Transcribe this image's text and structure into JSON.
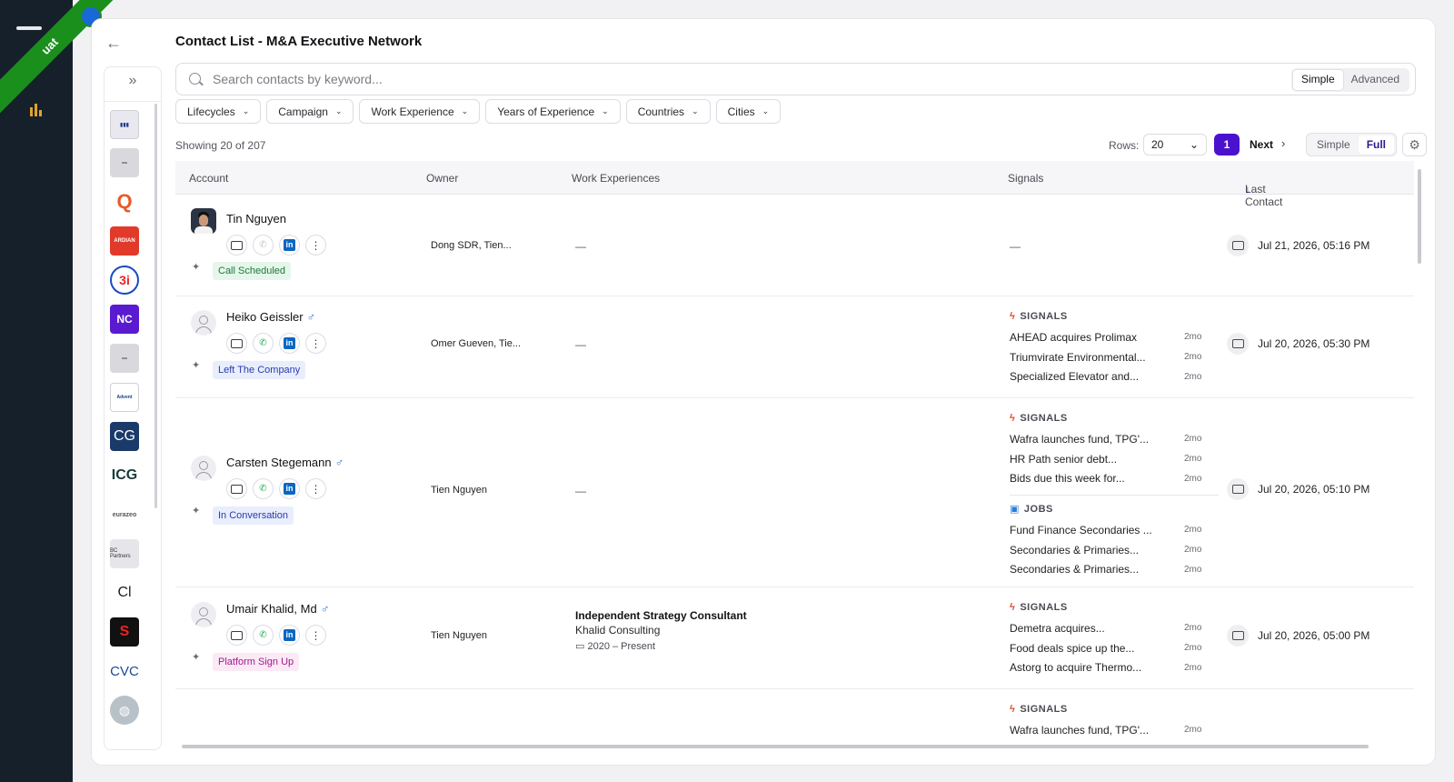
{
  "app": {
    "env_badge": "uat",
    "title": "Contact List - M&A Executive Network"
  },
  "search": {
    "placeholder": "Search contacts by keyword...",
    "modes": [
      "Simple",
      "Advanced"
    ],
    "active_mode": "Simple"
  },
  "filters": [
    "Lifecycles",
    "Campaign",
    "Work Experience",
    "Years of Experience",
    "Countries",
    "Cities"
  ],
  "toolbar": {
    "showing": "Showing 20 of 207",
    "rows_label": "Rows:",
    "rows_value": "20",
    "page": "1",
    "next": "Next",
    "views": [
      "Simple",
      "Full"
    ],
    "active_view": "Full"
  },
  "columns": [
    "Account",
    "Owner",
    "Work Experiences",
    "Signals",
    "Last Contact"
  ],
  "accounts": [
    "Bitcoin",
    "grey-logo",
    "Q-logo",
    "ARDIAN",
    "3i",
    "NC",
    "grey-logo-2",
    "Advent International",
    "CG",
    "ICG",
    "eurazeo",
    "BC Partners",
    "Cl",
    "red-swirl",
    "CVC",
    "globe"
  ],
  "rows": [
    {
      "name": "Tin Nguyen",
      "gender": "",
      "stage": "Call Scheduled",
      "owner": "Dong SDR, Tien...",
      "work": "—",
      "signals_text": "—",
      "last_contact": "Jul 21, 2026, 05:16 PM"
    },
    {
      "name": "Heiko Geissler",
      "gender": "♂",
      "stage": "Left The Company",
      "owner": "Omer Gueven, Tie...",
      "work": "—",
      "signals_label": "SIGNALS",
      "signals": [
        {
          "text": "AHEAD acquires Prolimax",
          "ago": "2mo"
        },
        {
          "text": "Triumvirate Environmental...",
          "ago": "2mo"
        },
        {
          "text": "Specialized Elevator and...",
          "ago": "2mo"
        }
      ],
      "last_contact": "Jul 20, 2026, 05:30 PM"
    },
    {
      "name": "Carsten Stegemann",
      "gender": "♂",
      "stage": "In Conversation",
      "owner": "Tien Nguyen",
      "work": "—",
      "signals_label": "SIGNALS",
      "signals": [
        {
          "text": "Wafra launches fund, TPG'...",
          "ago": "2mo"
        },
        {
          "text": "HR Path senior debt...",
          "ago": "2mo"
        },
        {
          "text": "Bids due this week for...",
          "ago": "2mo"
        }
      ],
      "jobs_label": "JOBS",
      "jobs": [
        {
          "text": "Fund Finance Secondaries ...",
          "ago": "2mo"
        },
        {
          "text": "Secondaries & Primaries...",
          "ago": "2mo"
        },
        {
          "text": "Secondaries & Primaries...",
          "ago": "2mo"
        }
      ],
      "last_contact": "Jul 20, 2026, 05:10 PM"
    },
    {
      "name": "Umair Khalid, Md",
      "gender": "♂",
      "stage": "Platform Sign Up",
      "owner": "Tien Nguyen",
      "work_title": "Independent Strategy Consultant",
      "work_company": "Khalid Consulting",
      "work_dates": "2020 – Present",
      "signals_label": "SIGNALS",
      "signals": [
        {
          "text": "Demetra acquires...",
          "ago": "2mo"
        },
        {
          "text": "Food deals spice up the...",
          "ago": "2mo"
        },
        {
          "text": "Astorg to acquire Thermo...",
          "ago": "2mo"
        }
      ],
      "last_contact": "Jul 20, 2026, 05:00 PM"
    },
    {
      "signals_label": "SIGNALS",
      "signals": [
        {
          "text": "Wafra launches fund, TPG'...",
          "ago": "2mo"
        }
      ]
    }
  ],
  "colors": {
    "rail": "#15202b",
    "accent": "#4a12cf",
    "ribbon": "#1a8f1c",
    "stage_green_bg": "#e6f6ea",
    "stage_blue_bg": "#e8eefc",
    "stage_purple_bg": "#fbe9f6"
  }
}
